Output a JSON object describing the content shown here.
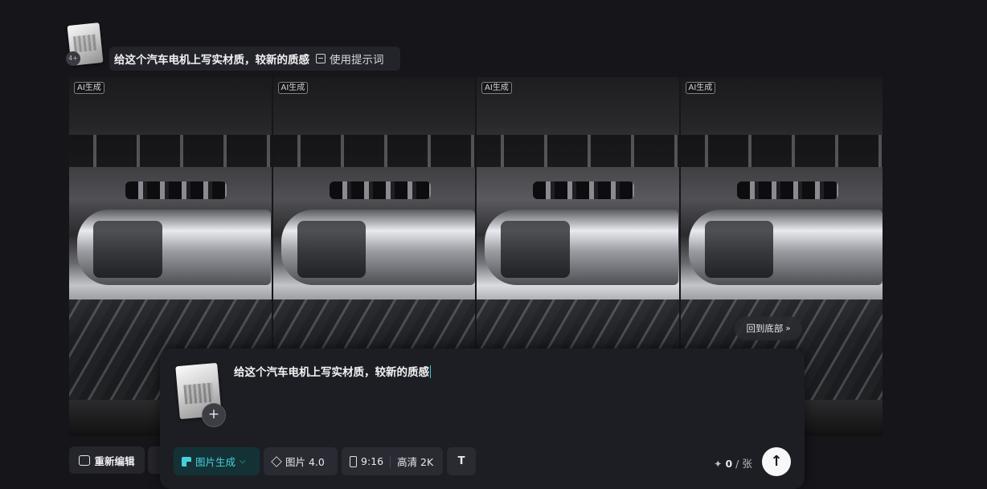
{
  "conversation": {
    "prompt_text": "给这个汽车电机上写实材质，较新的质感",
    "use_prompt_label": "使用提示词",
    "avatar_badge": "4+"
  },
  "gallery": {
    "tiles": [
      {
        "tag": "AI生成"
      },
      {
        "tag": "AI生成"
      },
      {
        "tag": "AI生成"
      },
      {
        "tag": "AI生成"
      }
    ],
    "back_to_bottom_label": "回到底部",
    "back_to_bottom_icon": "double-chevron-down-icon"
  },
  "actions": {
    "re_edit_label": "重新编辑",
    "re_edit_icon": "edit-icon"
  },
  "composer": {
    "input_value": "给这个汽车电机上写实材质，较新的质感",
    "add_reference_symbol": "+",
    "mode_label": "图片生成",
    "mode_icon": "image-gen-icon",
    "model_label": "图片 4.0",
    "model_icon": "cube-icon",
    "ratio_label": "9:16",
    "ratio_icon": "portrait-ratio-icon",
    "quality_label": "高清 2K",
    "text_tool_icon": "text-size-icon",
    "text_tool_glyph": "T",
    "credits_icon": "✦",
    "credits_value": "0",
    "credits_unit": "/ 张",
    "send_icon": "arrow-up-icon",
    "send_glyph": "↑"
  },
  "colors": {
    "background": "#15151a",
    "accent": "#44d1dc",
    "panel": "#1d1e24"
  }
}
